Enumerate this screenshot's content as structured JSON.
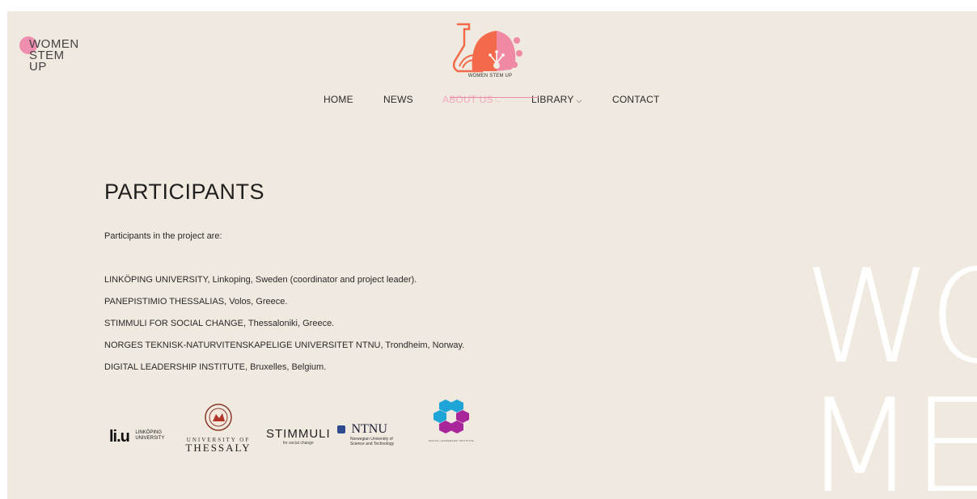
{
  "brand": {
    "wordmark_lines": [
      "WOMEN",
      "STEM",
      "UP"
    ],
    "logo_text": "WOMEN STEM UP",
    "colors": {
      "accent_pink": "#ef8fb0",
      "logo_orange": "#f26a4a",
      "background": "#f0e9df"
    }
  },
  "nav": {
    "items": [
      {
        "label": "HOME",
        "dropdown": false
      },
      {
        "label": "NEWS",
        "dropdown": false
      },
      {
        "label": "ABOUT US",
        "dropdown": true,
        "active": true
      },
      {
        "label": "LIBRARY",
        "dropdown": true
      },
      {
        "label": "CONTACT",
        "dropdown": false
      }
    ],
    "chevron": "⌵"
  },
  "main": {
    "title": "PARTICIPANTS",
    "intro": "Participants in the project are:",
    "participants": [
      "LINKÖPING UNIVERSITY, Linkoping, Sweden (coordinator and project leader).",
      "PANEPISTIMIO THESSALIAS, Volos, Greece.",
      "STIMMULI FOR SOCIAL CHANGE, Thessaloniki, Greece.",
      "NORGES TEKNISK-NATURVITENSKAPELIGE UNIVERSITET NTNU, Trondheim, Norway.",
      "DIGITAL LEADERSHIP INSTITUTE, Bruxelles, Belgium."
    ]
  },
  "partner_logos": {
    "liu": {
      "mark": "li.u",
      "line1": "LINKÖPING",
      "line2": "UNIVERSITY"
    },
    "thessaly": {
      "line1": "UNIVERSITY OF",
      "line2": "THESSALY"
    },
    "stimmuli": {
      "word": "STIMMULI",
      "tagline": "for social change"
    },
    "ntnu": {
      "word": "NTNU",
      "line1": "Norwegian University of",
      "line2": "Science and Technology"
    },
    "dli": {
      "caption": "DIGITAL LEADERSHIP INSTITUTE"
    }
  },
  "watermark": {
    "lines": [
      "WO",
      "ME"
    ]
  }
}
